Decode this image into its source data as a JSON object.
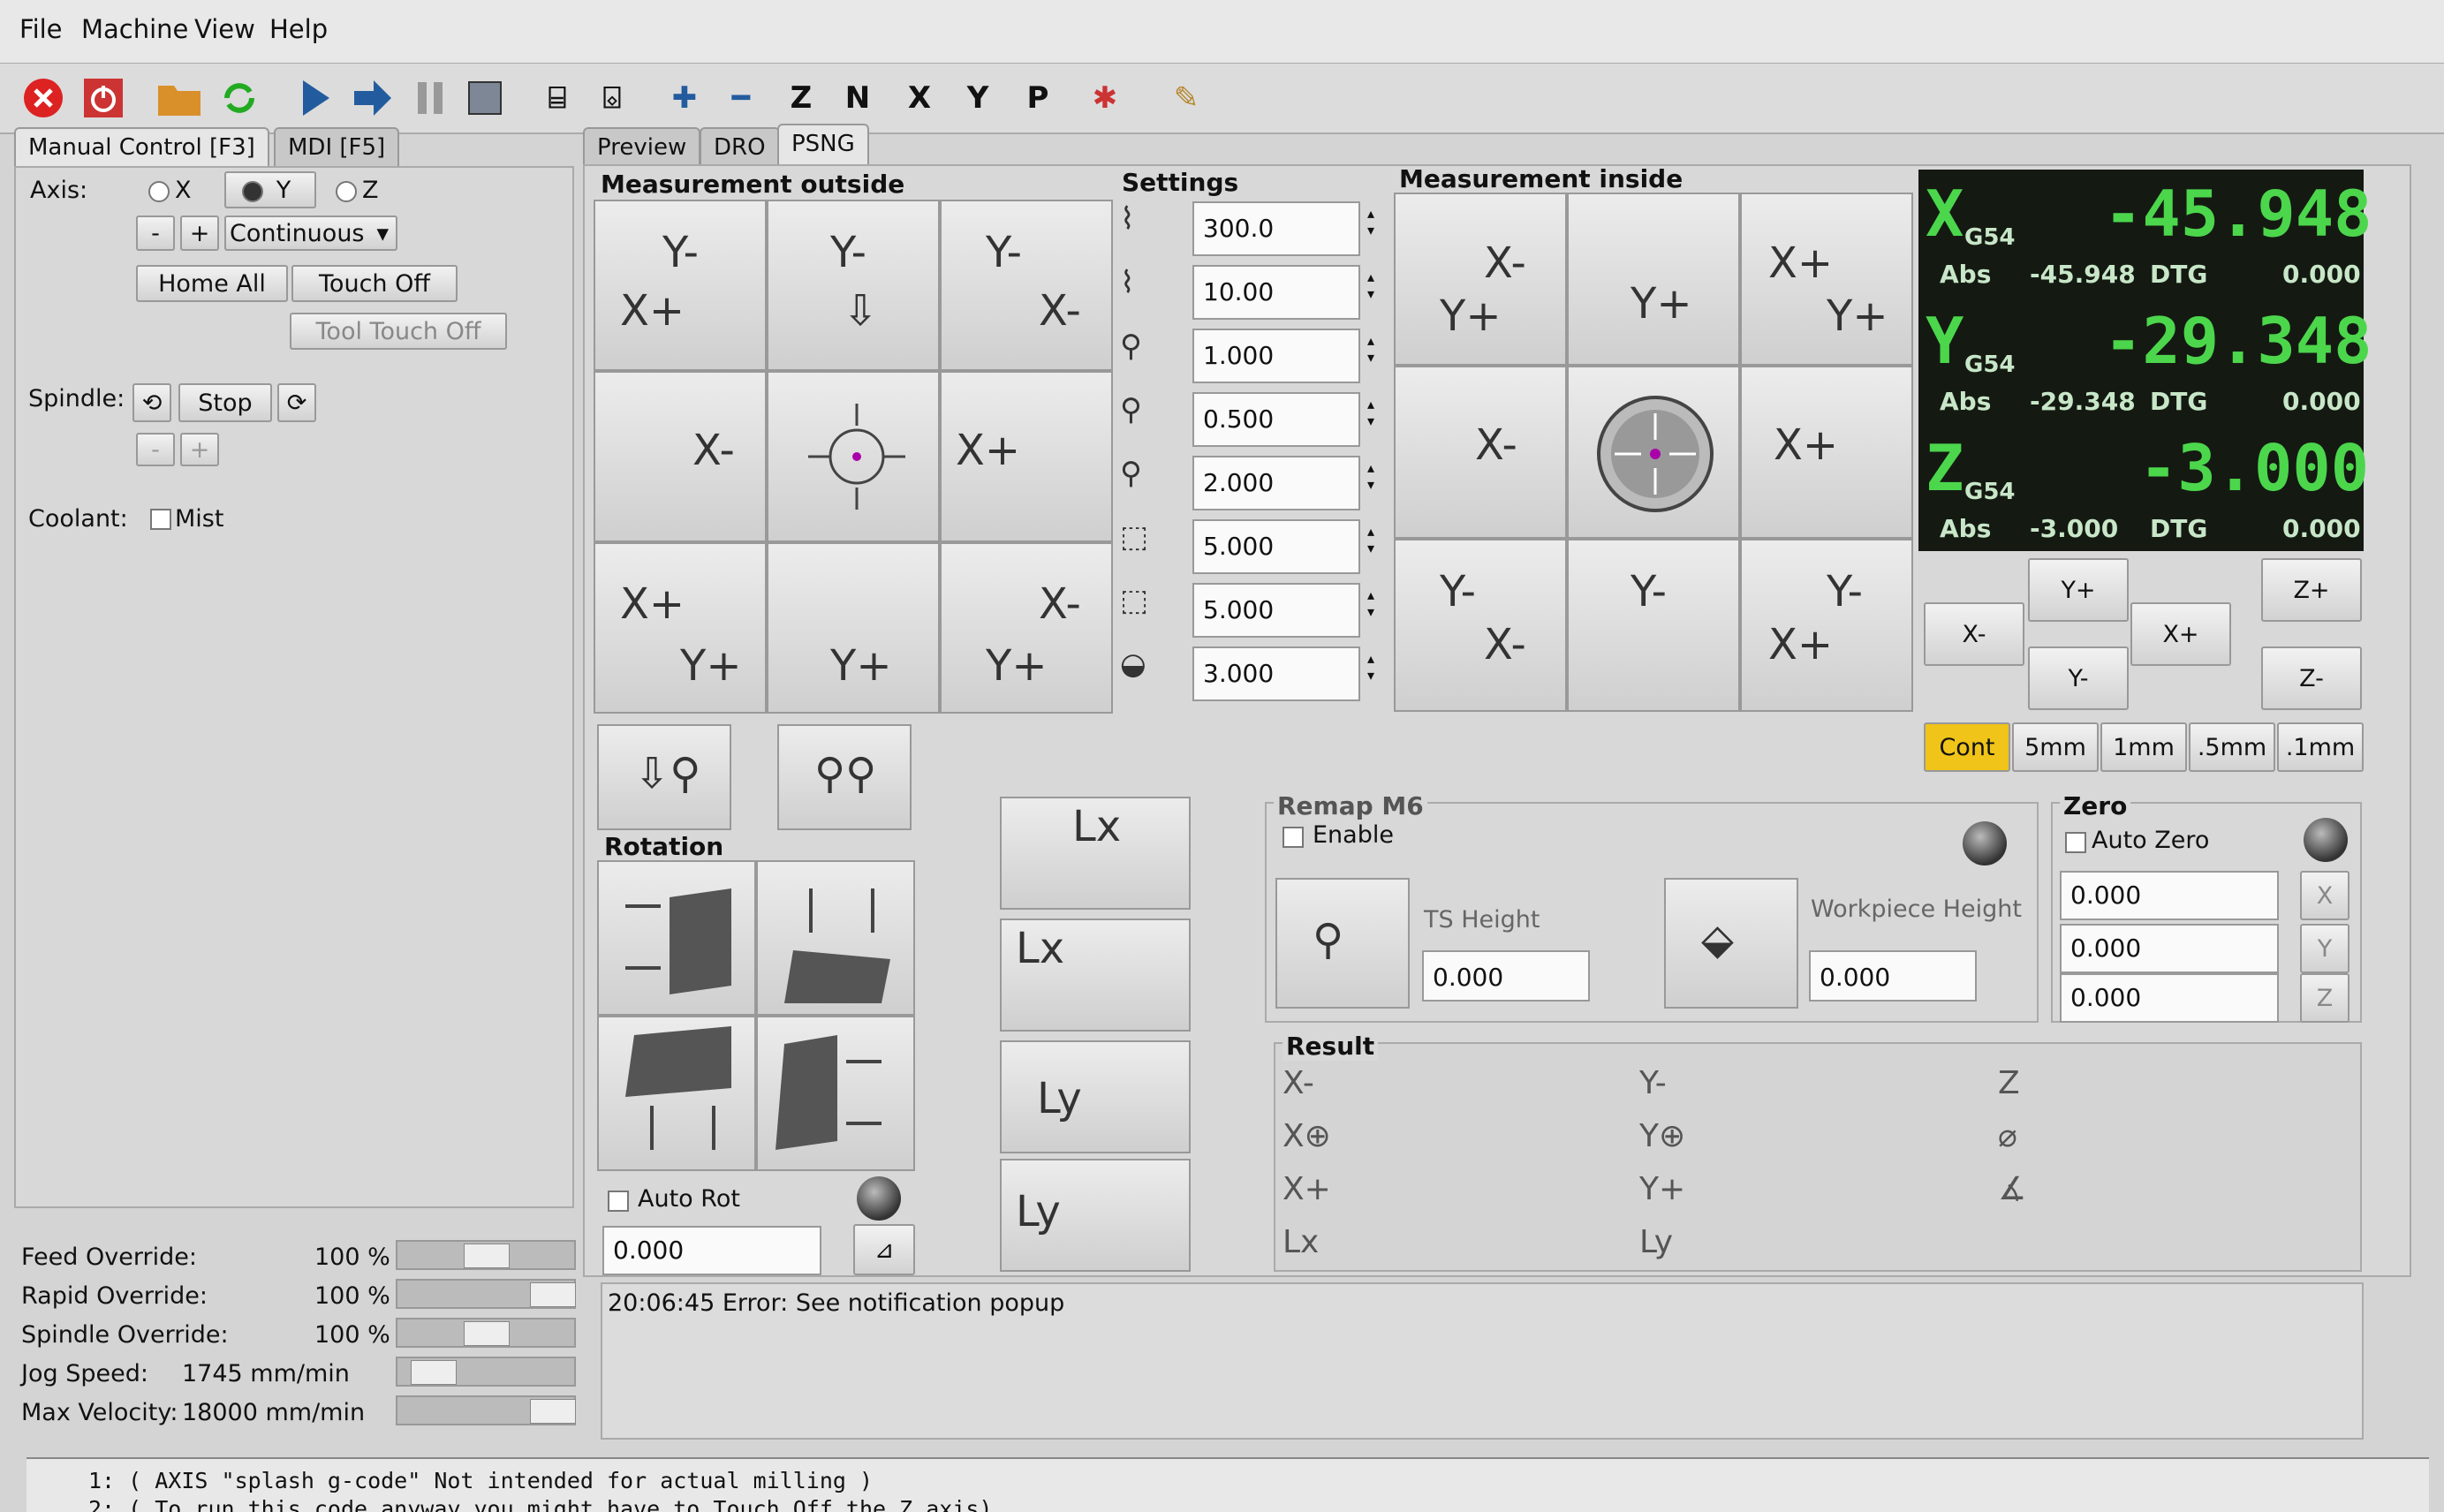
{
  "menu": [
    "File",
    "Machine",
    "View",
    "Help"
  ],
  "left_tabs": [
    "Manual Control [F3]",
    "MDI [F5]"
  ],
  "right_tabs": [
    "Preview",
    "DRO",
    "PSNG"
  ],
  "axis": {
    "label": "Axis:",
    "options": [
      "X",
      "Y",
      "Z"
    ],
    "selected": "Y",
    "minus": "-",
    "plus": "+",
    "mode": "Continuous"
  },
  "buttons": {
    "home_all": "Home All",
    "touch_off": "Touch Off",
    "tool_touch_off": "Tool Touch Off"
  },
  "spindle": {
    "label": "Spindle:",
    "stop": "Stop",
    "minus": "-",
    "plus": "+"
  },
  "coolant": {
    "label": "Coolant:",
    "mist": "Mist"
  },
  "overrides": [
    {
      "label": "Feed Override:",
      "value": "100 %",
      "fraction": 0.5
    },
    {
      "label": "Rapid Override:",
      "value": "100 %",
      "fraction": 1.0
    },
    {
      "label": "Spindle Override:",
      "value": "100 %",
      "fraction": 0.5
    },
    {
      "label": "Jog Speed:",
      "value": "1745 mm/min",
      "fraction": 0.1
    },
    {
      "label": "Max Velocity:",
      "value": "18000 mm/min",
      "fraction": 1.0
    }
  ],
  "psng": {
    "measurement_outside": "Measurement outside",
    "settings": "Settings",
    "measurement_inside": "Measurement inside",
    "settings_values": [
      "300.0",
      "10.00",
      "1.000",
      "0.500",
      "2.000",
      "5.000",
      "5.000",
      "3.000"
    ],
    "rotation": "Rotation",
    "auto_rot": "Auto Rot",
    "rot_value": "0.000",
    "remap": {
      "title": "Remap M6",
      "enable": "Enable",
      "ts_height": "TS Height",
      "ts_value": "0.000",
      "wp_height": "Workpiece Height",
      "wp_value": "0.000"
    },
    "zero": {
      "title": "Zero",
      "auto_zero": "Auto Zero",
      "values": [
        "0.000",
        "0.000",
        "0.000"
      ]
    },
    "result": "Result",
    "lx": "Lx",
    "ly": "Ly"
  },
  "dro": [
    {
      "axis": "X",
      "coord": "G54",
      "value": "-45.948",
      "abs_label": "Abs",
      "abs": "-45.948",
      "dtg_label": "DTG",
      "dtg": "0.000"
    },
    {
      "axis": "Y",
      "coord": "G54",
      "value": "-29.348",
      "abs_label": "Abs",
      "abs": "-29.348",
      "dtg_label": "DTG",
      "dtg": "0.000"
    },
    {
      "axis": "Z",
      "coord": "G54",
      "value": "-3.000",
      "abs_label": "Abs",
      "abs": "-3.000",
      "dtg_label": "DTG",
      "dtg": "0.000"
    }
  ],
  "jog": {
    "yplus": "Y+",
    "yminus": "Y-",
    "xminus": "X-",
    "xplus": "X+",
    "zplus": "Z+",
    "zminus": "Z-"
  },
  "increments": [
    "Cont",
    "5mm",
    "1mm",
    ".5mm",
    ".1mm"
  ],
  "notification": "20:06:45  Error: See notification popup",
  "gcode_lines": [
    "1: ( AXIS \"splash g-code\" Not intended for actual milling )",
    "2: ( To run this code anyway you might have to Touch Off the Z axis)"
  ]
}
